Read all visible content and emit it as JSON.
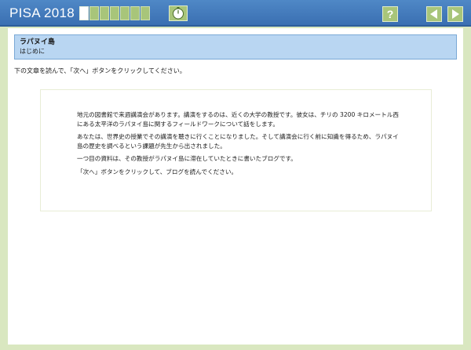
{
  "app": {
    "title": "PISA 2018",
    "progress": {
      "total": 7,
      "completed": 1
    },
    "help_label": "?"
  },
  "header": {
    "title": "ラパヌイ島",
    "subtitle": "はじめに"
  },
  "instruction": "下の文章を読んで、「次へ」ボタンをクリックしてください。",
  "passage": {
    "paragraphs": [
      "地元の図書館で来週講演会があります。講演をするのは、近くの大学の教授です。彼女は、チリの 3200 キロメートル西にある太平洋のラパヌイ島に関するフィールドワークについて話をします。",
      "あなたは、世界史の授業でその講演を聴きに行くことになりました。そして講演会に行く前に知識を得るため、ラパヌイ島の歴史を調べるという課題が先生から出されました。",
      "一つ目の資料は、その教授がラパヌイ島に滞在していたときに書いたブログです。",
      "「次へ」ボタンをクリックして、ブログを読んでください。"
    ]
  },
  "colors": {
    "topbar": "#3a6fb2",
    "accent_green": "#a8c57a",
    "header_blue": "#b9d6f2"
  },
  "icons": [
    "timer-icon",
    "help-icon",
    "arrow-left-icon",
    "arrow-right-icon"
  ]
}
